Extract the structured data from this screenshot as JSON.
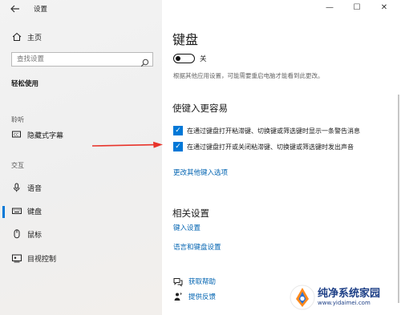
{
  "window": {
    "app_title": "设置"
  },
  "sidebar": {
    "home": {
      "label": "主页",
      "icon": "home-icon"
    },
    "search": {
      "placeholder": "查找设置",
      "icon": "search-icon"
    },
    "section_title": "轻松使用",
    "groups": [
      {
        "label": "聆听",
        "items": [
          {
            "label": "隐藏式字幕",
            "icon": "closed-captions-icon"
          }
        ]
      },
      {
        "label": "交互",
        "items": [
          {
            "label": "语音",
            "icon": "microphone-icon"
          },
          {
            "label": "键盘",
            "icon": "keyboard-icon",
            "selected": true
          },
          {
            "label": "鼠标",
            "icon": "mouse-icon"
          },
          {
            "label": "目视控制",
            "icon": "eye-control-icon"
          }
        ]
      }
    ]
  },
  "window_controls": {
    "minimize": "—",
    "maximize": "☐",
    "close": "✕"
  },
  "main": {
    "title": "键盘",
    "toggle": {
      "state_label": "关",
      "on": false
    },
    "note": "根据其他应用设置，可能需要重启电脑才能看到此更改。",
    "easy_typing": {
      "heading": "使键入更容易",
      "options": [
        {
          "label": "在通过键盘打开粘滞键、切换键或筛选键时显示一条警告消息",
          "checked": true
        },
        {
          "label": "在通过键盘打开或关闭粘滞键、切换键或筛选键时发出声音",
          "checked": true
        }
      ],
      "link": "更改其他键入选项"
    },
    "related": {
      "heading": "相关设置",
      "links": [
        "键入设置",
        "语言和键盘设置"
      ]
    },
    "help": [
      {
        "label": "获取帮助",
        "icon": "chat-help-icon"
      },
      {
        "label": "提供反馈",
        "icon": "feedback-icon"
      }
    ]
  },
  "watermark": {
    "title": "纯净系统家园",
    "url": "www.yidaimei.com"
  },
  "colors": {
    "accent": "#0078d7",
    "link": "#0063b1",
    "arrow": "#e8332a",
    "watermark": "#1d3f86"
  }
}
